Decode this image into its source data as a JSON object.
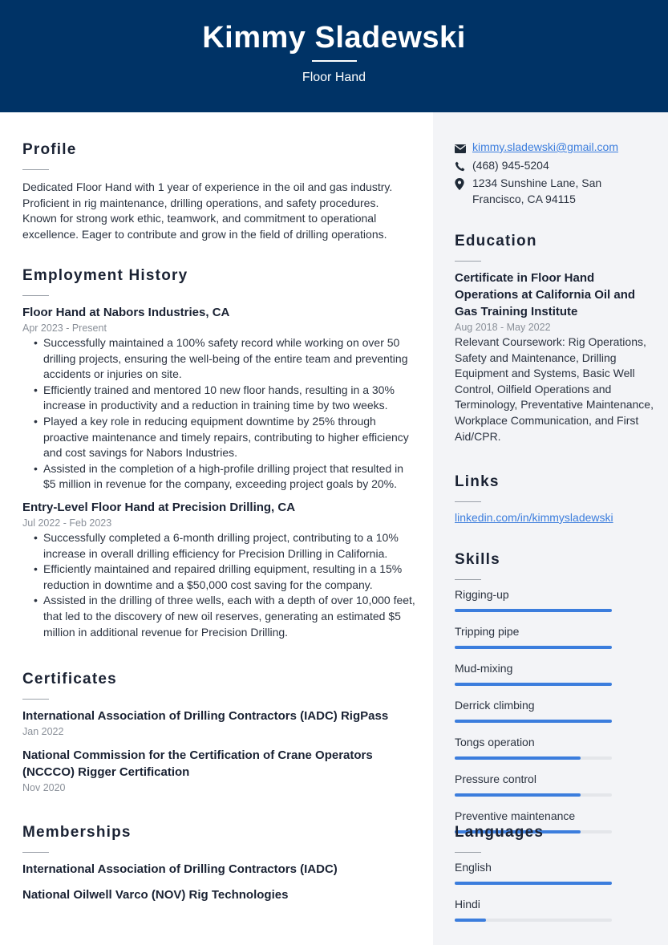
{
  "header": {
    "name": "Kimmy Sladewski",
    "title": "Floor Hand",
    "background": "#003366"
  },
  "profile": {
    "heading": "Profile",
    "text": "Dedicated Floor Hand with 1 year of experience in the oil and gas industry. Proficient in rig maintenance, drilling operations, and safety procedures. Known for strong work ethic, teamwork, and commitment to operational excellence. Eager to contribute and grow in the field of drilling operations."
  },
  "employment": {
    "heading": "Employment History",
    "jobs": [
      {
        "title": "Floor Hand at Nabors Industries, CA",
        "dates": "Apr 2023 - Present",
        "bullets": [
          "Successfully maintained a 100% safety record while working on over 50 drilling projects, ensuring the well-being of the entire team and preventing accidents or injuries on site.",
          "Efficiently trained and mentored 10 new floor hands, resulting in a 30% increase in productivity and a reduction in training time by two weeks.",
          "Played a key role in reducing equipment downtime by 25% through proactive maintenance and timely repairs, contributing to higher efficiency and cost savings for Nabors Industries.",
          "Assisted in the completion of a high-profile drilling project that resulted in $5 million in revenue for the company, exceeding project goals by 20%."
        ]
      },
      {
        "title": "Entry-Level Floor Hand at Precision Drilling, CA",
        "dates": "Jul 2022 - Feb 2023",
        "bullets": [
          "Successfully completed a 6-month drilling project, contributing to a 10% increase in overall drilling efficiency for Precision Drilling in California.",
          "Efficiently maintained and repaired drilling equipment, resulting in a 15% reduction in downtime and a $50,000 cost saving for the company.",
          "Assisted in the drilling of three wells, each with a depth of over 10,000 feet, that led to the discovery of new oil reserves, generating an estimated $5 million in additional revenue for Precision Drilling."
        ]
      }
    ]
  },
  "certificates": {
    "heading": "Certificates",
    "items": [
      {
        "title": "International Association of Drilling Contractors (IADC) RigPass",
        "date": "Jan 2022"
      },
      {
        "title": "National Commission for the Certification of Crane Operators (NCCCO) Rigger Certification",
        "date": "Nov 2020"
      }
    ]
  },
  "memberships": {
    "heading": "Memberships",
    "items": [
      "International Association of Drilling Contractors (IADC)",
      "National Oilwell Varco (NOV) Rig Technologies"
    ]
  },
  "contact": {
    "email": "kimmy.sladewski@gmail.com",
    "phone": "(468) 945-5204",
    "address": "1234 Sunshine Lane, San Francisco, CA 94115",
    "icons": [
      "envelope-icon",
      "phone-icon",
      "map-pin-icon"
    ]
  },
  "education": {
    "heading": "Education",
    "title": "Certificate in Floor Hand Operations at California Oil and Gas Training Institute",
    "dates": "Aug 2018 - May 2022",
    "description": "Relevant Coursework: Rig Operations, Safety and Maintenance, Drilling Equipment and Systems, Basic Well Control, Oilfield Operations and Terminology, Preventative Maintenance, Workplace Communication, and First Aid/CPR."
  },
  "links": {
    "heading": "Links",
    "items": [
      "linkedin.com/in/kimmysladewski"
    ]
  },
  "skills": {
    "heading": "Skills",
    "accent": "#3b7ddd",
    "items": [
      {
        "label": "Rigging-up",
        "level": 1.0
      },
      {
        "label": "Tripping pipe",
        "level": 1.0
      },
      {
        "label": "Mud-mixing",
        "level": 1.0
      },
      {
        "label": "Derrick climbing",
        "level": 1.0
      },
      {
        "label": "Tongs operation",
        "level": 0.8
      },
      {
        "label": "Pressure control",
        "level": 0.8
      },
      {
        "label": "Preventive maintenance",
        "level": 0.8
      }
    ]
  },
  "languages": {
    "heading": "Languages",
    "items": [
      {
        "label": "English",
        "level": 1.0
      },
      {
        "label": "Hindi",
        "level": 0.2
      }
    ]
  }
}
